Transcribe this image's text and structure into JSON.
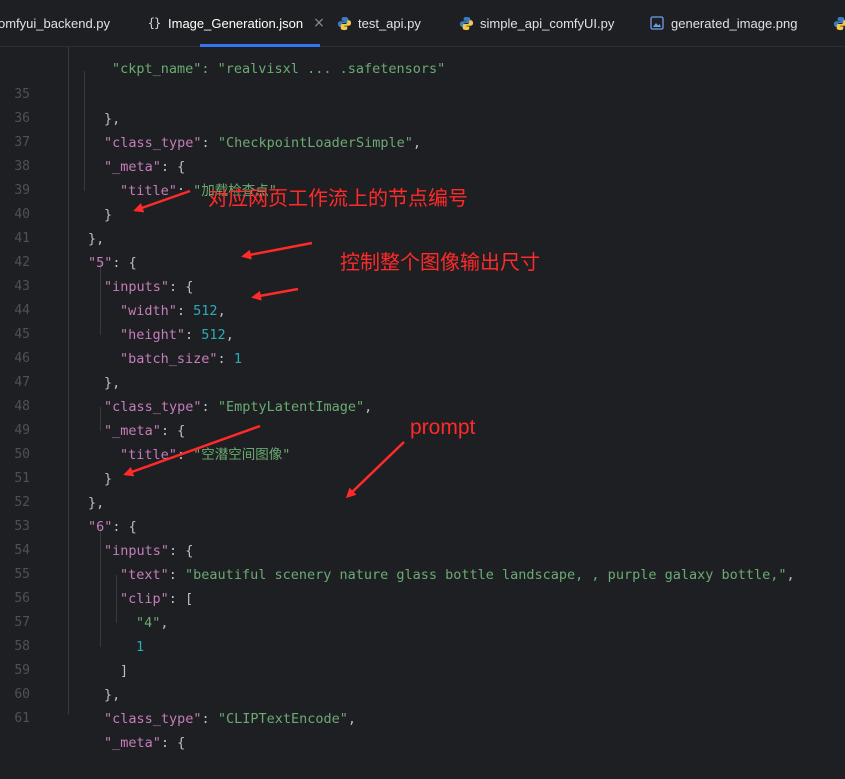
{
  "tabs": [
    {
      "label": "omfyui_backend.py",
      "icon": "python-icon",
      "active": false
    },
    {
      "label": "Image_Generation.json",
      "icon": "json-icon",
      "active": true
    },
    {
      "label": "test_api.py",
      "icon": "python-icon",
      "active": false
    },
    {
      "label": "simple_api_comfyUI.py",
      "icon": "python-icon",
      "active": false
    },
    {
      "label": "generated_image.png",
      "icon": "image-icon",
      "active": false
    }
  ],
  "json_icon_glyph": "{}",
  "close_glyph": "×",
  "editor": {
    "top_partial_line": "\"ckpt_name\": \"realvisxl ... .safetensors\"",
    "lines": [
      {
        "n": "35"
      },
      {
        "n": "36"
      },
      {
        "n": "37"
      },
      {
        "n": "38"
      },
      {
        "n": "39"
      },
      {
        "n": "40"
      },
      {
        "n": "41"
      },
      {
        "n": "42"
      },
      {
        "n": "43"
      },
      {
        "n": "44"
      },
      {
        "n": "45"
      },
      {
        "n": "46"
      },
      {
        "n": "47"
      },
      {
        "n": "48"
      },
      {
        "n": "49"
      },
      {
        "n": "50"
      },
      {
        "n": "51"
      },
      {
        "n": "52"
      },
      {
        "n": "53"
      },
      {
        "n": "54"
      },
      {
        "n": "55"
      },
      {
        "n": "56"
      },
      {
        "n": "57"
      },
      {
        "n": "58"
      },
      {
        "n": "59"
      },
      {
        "n": "60"
      },
      {
        "n": "61"
      }
    ],
    "tokens": {
      "k_class_type": "\"class_type\"",
      "k_meta": "\"_meta\"",
      "k_title": "\"title\"",
      "k_inputs": "\"inputs\"",
      "k_width": "\"width\"",
      "k_height": "\"height\"",
      "k_batch": "\"batch_size\"",
      "k_text": "\"text\"",
      "k_clip": "\"clip\"",
      "k_5": "\"5\"",
      "k_6": "\"6\"",
      "s_ckpt": "\"CheckpointLoaderSimple\"",
      "s_title1": "\"加载检查点\"",
      "s_empty": "\"EmptyLatentImage\"",
      "s_title2": "\"空潜空间图像\"",
      "s_prompt": "\"beautiful scenery nature glass bottle landscape, , purple galaxy bottle,\"",
      "s_4": "\"4\"",
      "s_clipenc": "\"CLIPTextEncode\"",
      "n_512a": "512",
      "n_512b": "512",
      "n_1": "1",
      "n_1b": "1"
    }
  },
  "annotations": {
    "node_id": "对应网页工作流上的节点编号",
    "size": "控制整个图像输出尺寸",
    "prompt": "prompt",
    "color": "#ff2a2a"
  }
}
